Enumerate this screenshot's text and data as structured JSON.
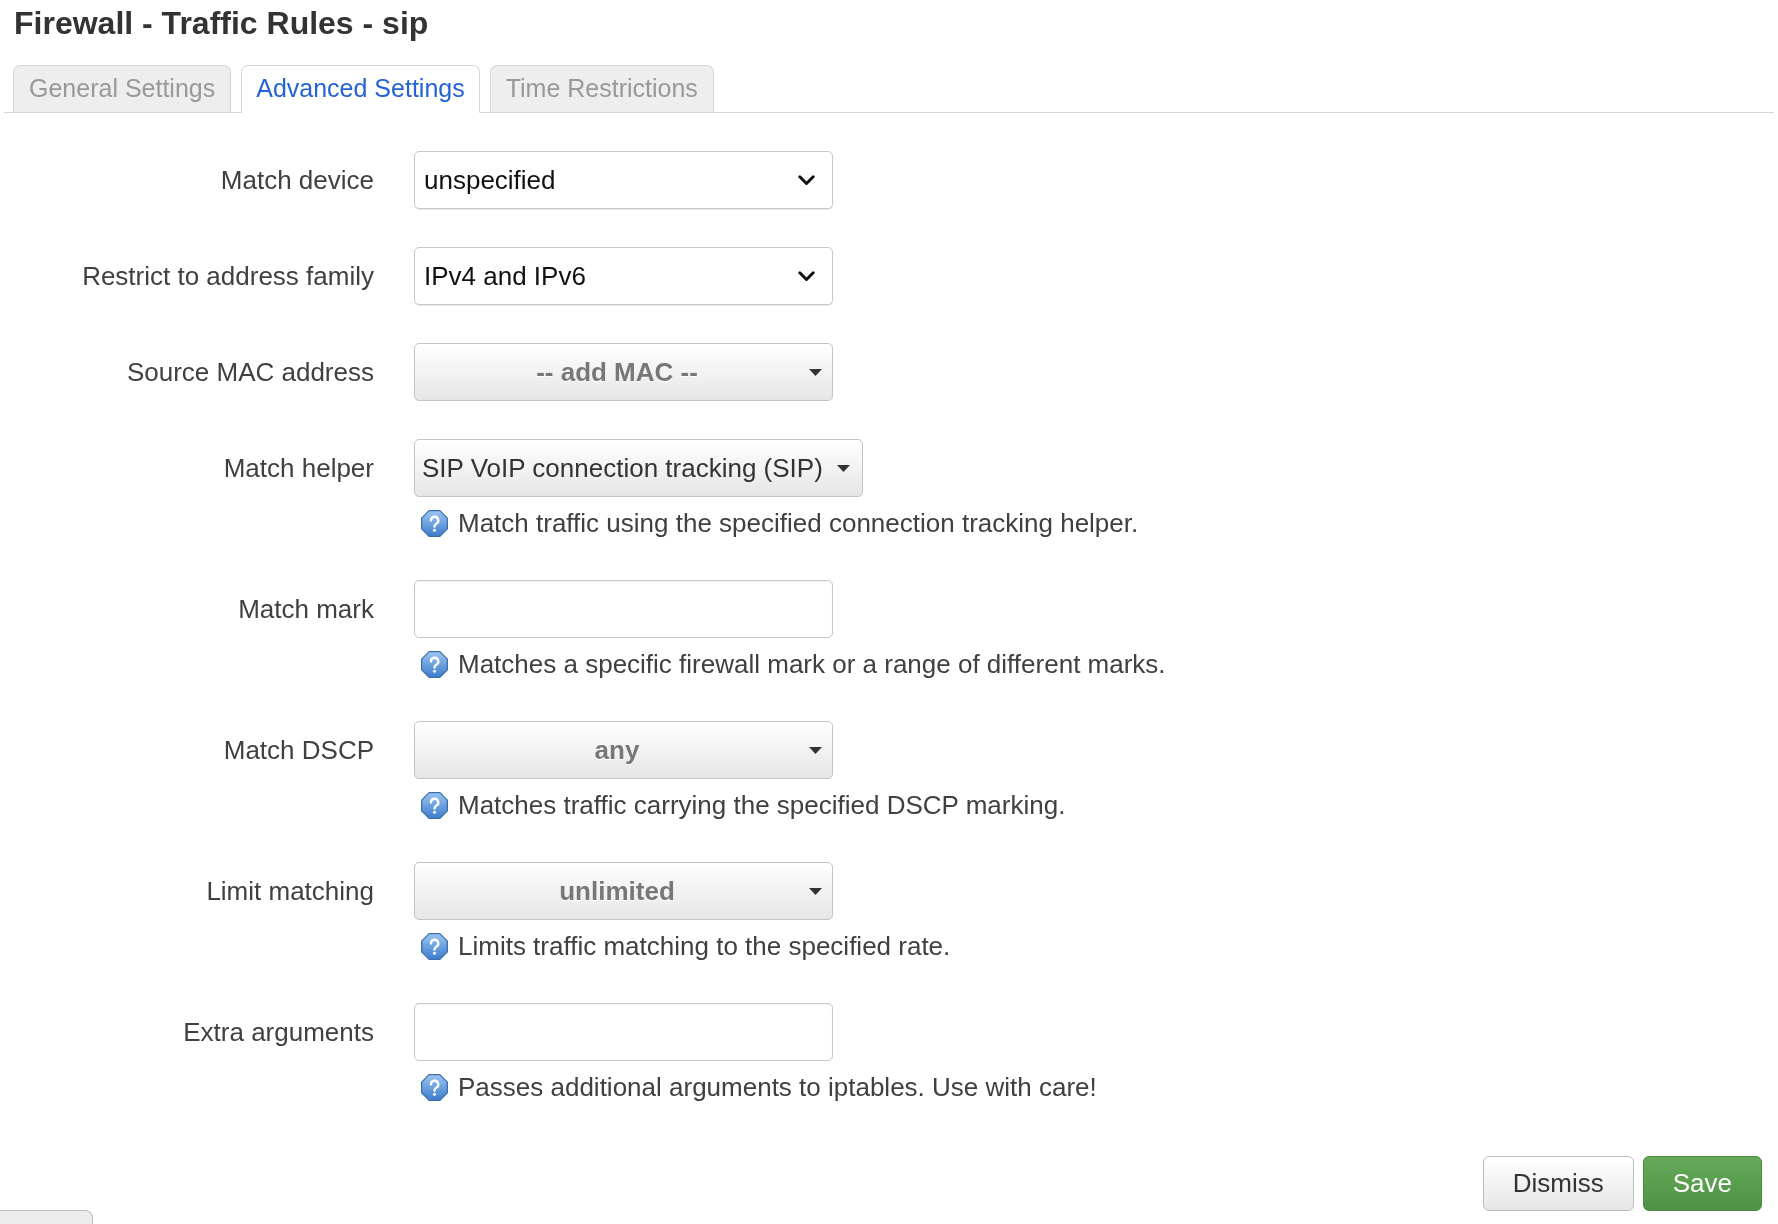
{
  "page_title": "Firewall - Traffic Rules - sip",
  "tabs": [
    {
      "label": "General Settings",
      "selected": false
    },
    {
      "label": "Advanced Settings",
      "selected": true
    },
    {
      "label": "Time Restrictions",
      "selected": false
    }
  ],
  "fields": [
    {
      "label": "Match device",
      "kind": "select",
      "value": "unspecified"
    },
    {
      "label": "Restrict to address family",
      "kind": "select",
      "value": "IPv4 and IPv6"
    },
    {
      "label": "Source MAC address",
      "kind": "dropdown",
      "placeholder": "-- add MAC --"
    },
    {
      "label": "Match helper",
      "kind": "dropdown",
      "value": "SIP VoIP connection tracking (SIP)",
      "help": "Match traffic using the specified connection tracking helper."
    },
    {
      "label": "Match mark",
      "kind": "text",
      "help": "Matches a specific firewall mark or a range of different marks."
    },
    {
      "label": "Match DSCP",
      "kind": "dropdown",
      "placeholder": "any",
      "help": "Matches traffic carrying the specified DSCP marking."
    },
    {
      "label": "Limit matching",
      "kind": "dropdown",
      "placeholder": "unlimited",
      "help": "Limits traffic matching to the specified rate."
    },
    {
      "label": "Extra arguments",
      "kind": "text",
      "help": "Passes additional arguments to iptables. Use with care!"
    }
  ],
  "buttons": [
    {
      "label": "Dismiss",
      "kind": "secondary"
    },
    {
      "label": "Save",
      "kind": "primary"
    }
  ]
}
